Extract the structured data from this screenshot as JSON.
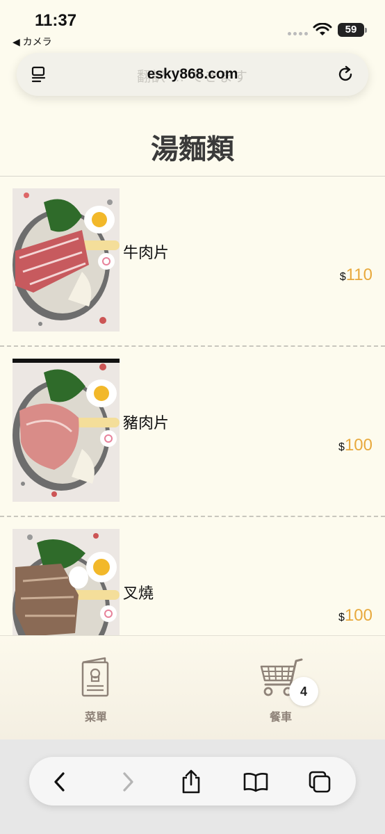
{
  "status": {
    "time": "11:37",
    "back_app": "◀ カメラ",
    "battery": "59"
  },
  "url_bar": {
    "ghost_text": "翻訳 … できます",
    "url": "esky868.com"
  },
  "page": {
    "title": "湯麵類"
  },
  "menu": {
    "items": [
      {
        "name": "牛肉片",
        "currency": "$",
        "price": "110",
        "meat_color": "#c75a5e"
      },
      {
        "name": "豬肉片",
        "currency": "$",
        "price": "100",
        "meat_color": "#d98c88"
      },
      {
        "name": "叉燒",
        "currency": "$",
        "price": "100",
        "meat_color": "#8a6a55"
      }
    ]
  },
  "bottom_nav": {
    "menu_label": "菜單",
    "cart_label": "餐車",
    "cart_count": "4"
  },
  "colors": {
    "background": "#fdfbee",
    "price_accent": "#e8a93d",
    "nav_icon": "#8e8278"
  }
}
